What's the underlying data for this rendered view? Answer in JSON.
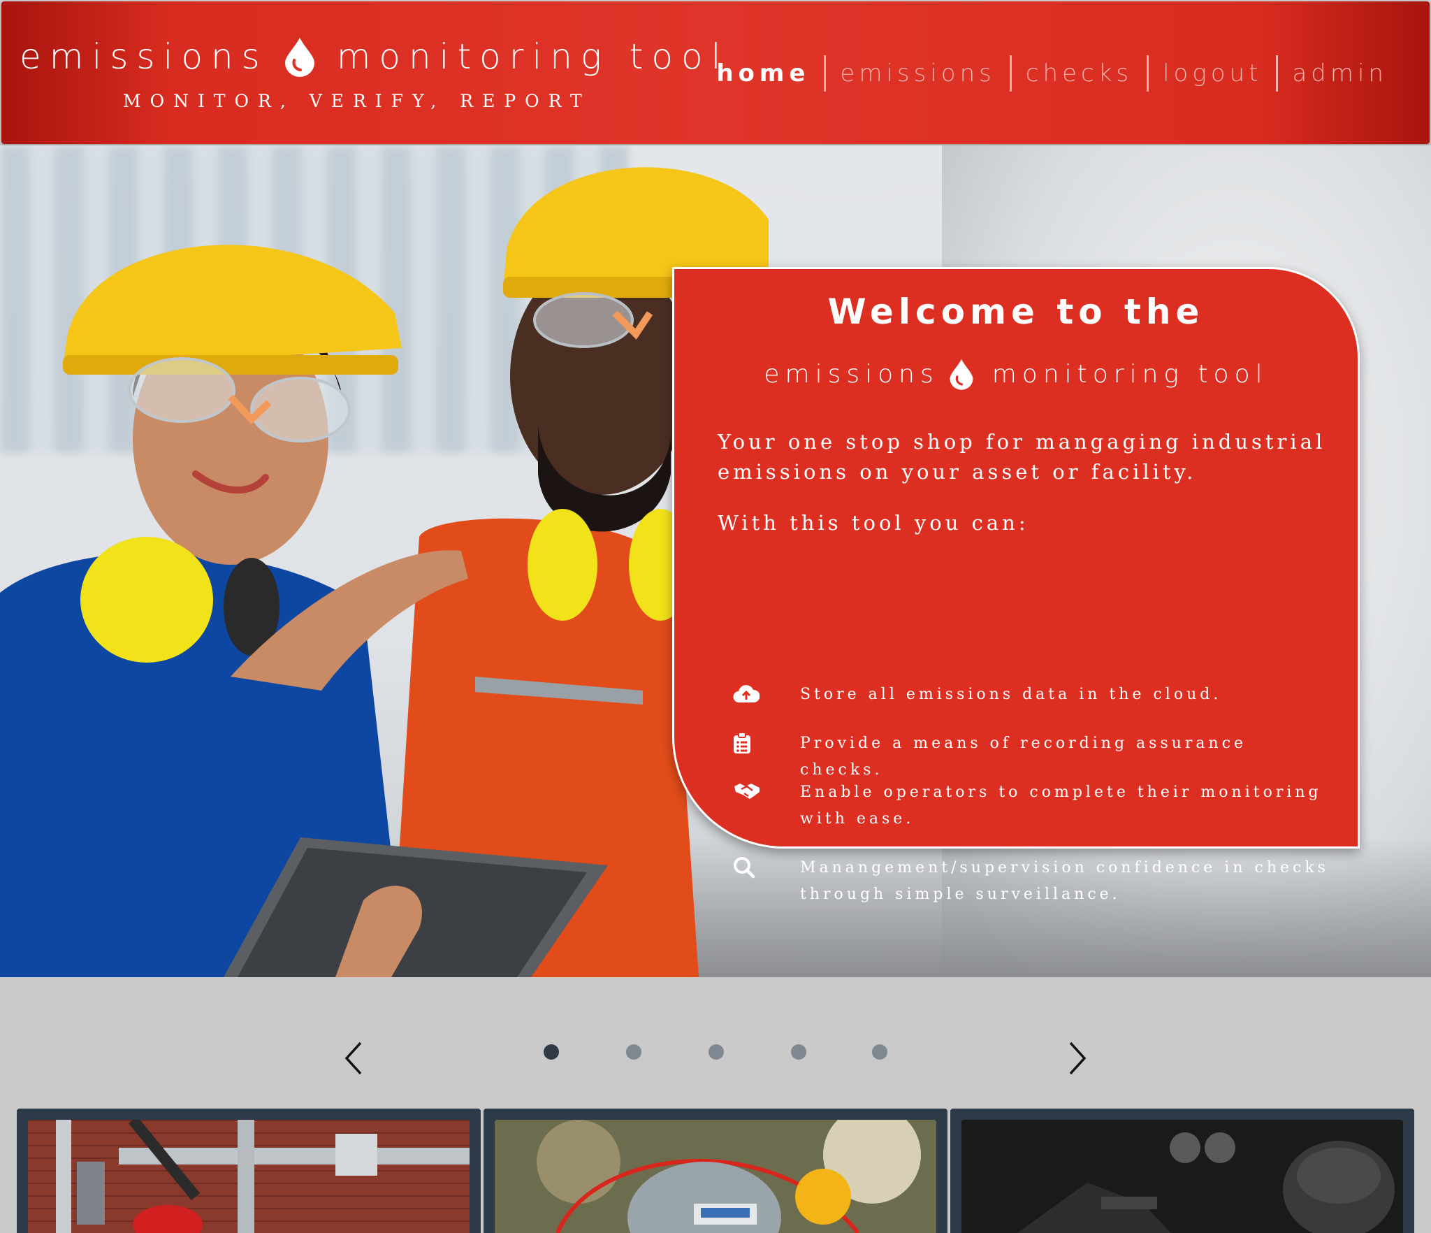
{
  "header": {
    "brand_left": "emissions",
    "brand_right": "monitoring tool",
    "tagline": "MONITOR, VERIFY, REPORT",
    "nav": [
      {
        "label": "home",
        "active": true
      },
      {
        "label": "emissions",
        "active": false
      },
      {
        "label": "checks",
        "active": false
      },
      {
        "label": "logout",
        "active": false
      },
      {
        "label": "admin",
        "active": false
      }
    ]
  },
  "welcome": {
    "title": "Welcome to the",
    "brand_left": "emissions",
    "brand_right": "monitoring tool",
    "intro": "Your one stop shop for mangaging industrial emissions on your asset or facility.",
    "subheading": "With this tool you can:",
    "features": [
      {
        "icon": "cloud-upload-icon",
        "text": "Store all emissions data in the cloud."
      },
      {
        "icon": "clipboard-list-icon",
        "text": "Provide a means of recording assurance checks."
      },
      {
        "icon": "handshake-icon",
        "text": "Enable operators to complete their monitoring with ease."
      },
      {
        "icon": "search-icon",
        "text": "Manangement/supervision confidence in checks through simple surveillance."
      }
    ]
  },
  "carousel": {
    "slide_count": 5,
    "active_index": 0
  },
  "colors": {
    "brand_red": "#dc2f22",
    "nav_inactive": "#f3b4ad",
    "card_bg": "#2c3b47",
    "dot_active": "#2f3a46",
    "dot_inactive": "#7f8790"
  }
}
